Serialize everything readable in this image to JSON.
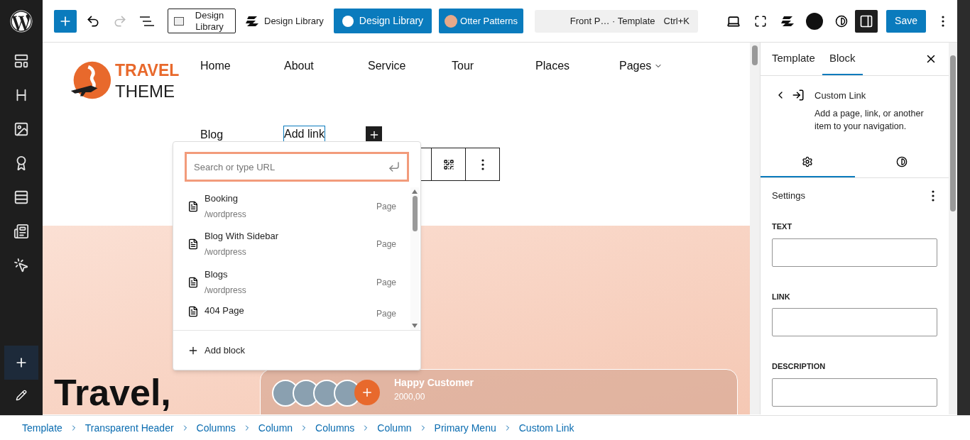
{
  "toolbar": {
    "library_buttons": [
      {
        "kind": "boxed",
        "label": "Design Library"
      },
      {
        "kind": "plain",
        "label": "Design Library"
      },
      {
        "kind": "blue",
        "label": "Design Library"
      },
      {
        "kind": "avatar",
        "label": "Otter Patterns"
      }
    ],
    "command_bar": {
      "title": "Front P…",
      "context": "· Template",
      "shortcut": "Ctrl+K"
    },
    "panel_toggle": {
      "pressed": true
    },
    "save": "Save"
  },
  "canvas": {
    "logo": {
      "line1": "TRAVEL",
      "line2": "THEME"
    },
    "nav": [
      {
        "label": "Home",
        "selected": false
      },
      {
        "label": "About",
        "selected": false
      },
      {
        "label": "Service",
        "selected": false
      },
      {
        "label": "Tour",
        "selected": false
      },
      {
        "label": "Places",
        "selected": false
      },
      {
        "label": "Pages",
        "selected": false,
        "submenu": true
      },
      {
        "label": "Blog",
        "selected": false
      },
      {
        "label": "Add link",
        "selected": true
      }
    ],
    "hero_title": "Travel,",
    "customer_card": {
      "title": "Happy Customer",
      "count": "2000,00"
    }
  },
  "link_popover": {
    "search": {
      "placeholder": "Search or type URL"
    },
    "results": [
      {
        "title": "Booking",
        "url": "/wordpress",
        "type": "Page"
      },
      {
        "title": "Blog With Sidebar",
        "url": "/wordpress",
        "type": "Page"
      },
      {
        "title": "Blogs",
        "url": "/wordpress",
        "type": "Page"
      },
      {
        "title": "404 Page",
        "type": "Page"
      }
    ],
    "add_block": "Add block"
  },
  "inspector": {
    "tabs": [
      {
        "label": "Template",
        "selected": false
      },
      {
        "label": "Block",
        "selected": true
      }
    ],
    "block": {
      "title": "Custom Link",
      "description": "Add a page, link, or another item to your navigation."
    },
    "subtabs": [
      {
        "kind": "settings",
        "selected": true
      },
      {
        "kind": "styles",
        "selected": false
      }
    ],
    "section_title": "Settings",
    "fields": [
      {
        "label": "TEXT"
      },
      {
        "label": "LINK"
      },
      {
        "label": "DESCRIPTION"
      }
    ]
  },
  "breadcrumbs": [
    "Template",
    "Transparent Header",
    "Columns",
    "Column",
    "Columns",
    "Column",
    "Primary Menu",
    "Custom Link"
  ]
}
